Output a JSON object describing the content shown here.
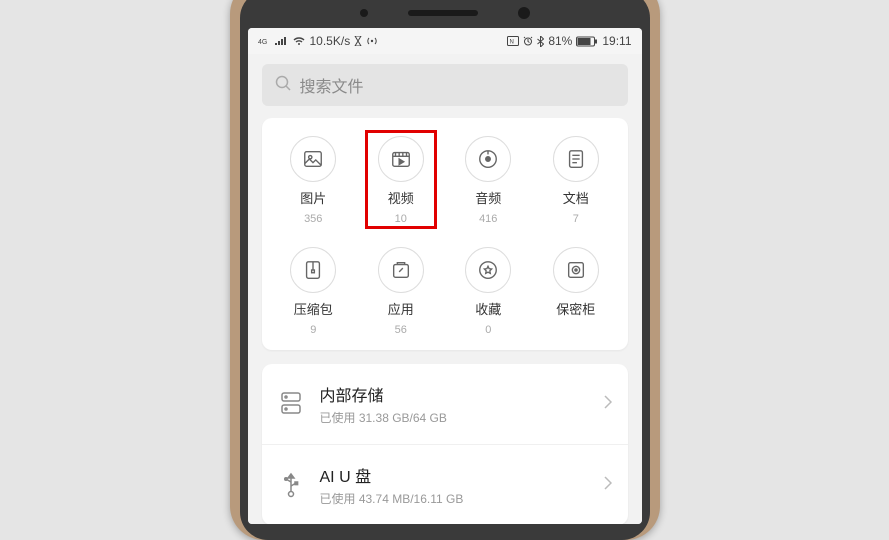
{
  "statusbar": {
    "speed": "10.5K/s",
    "battery": "81%",
    "time": "19:11"
  },
  "search": {
    "placeholder": "搜索文件"
  },
  "categories": [
    {
      "label": "图片",
      "count": "356",
      "icon": "image",
      "highlight": false
    },
    {
      "label": "视频",
      "count": "10",
      "icon": "video",
      "highlight": true
    },
    {
      "label": "音频",
      "count": "416",
      "icon": "audio",
      "highlight": false
    },
    {
      "label": "文档",
      "count": "7",
      "icon": "doc",
      "highlight": false
    },
    {
      "label": "压缩包",
      "count": "9",
      "icon": "archive",
      "highlight": false
    },
    {
      "label": "应用",
      "count": "56",
      "icon": "app",
      "highlight": false
    },
    {
      "label": "收藏",
      "count": "0",
      "icon": "favorite",
      "highlight": false
    },
    {
      "label": "保密柜",
      "count": "",
      "icon": "safe",
      "highlight": false
    }
  ],
  "storage": [
    {
      "title": "内部存储",
      "sub": "已使用 31.38 GB/64 GB",
      "icon": "internal"
    },
    {
      "title": "AI U 盘",
      "sub": "已使用 43.74 MB/16.11 GB",
      "icon": "usb"
    }
  ]
}
